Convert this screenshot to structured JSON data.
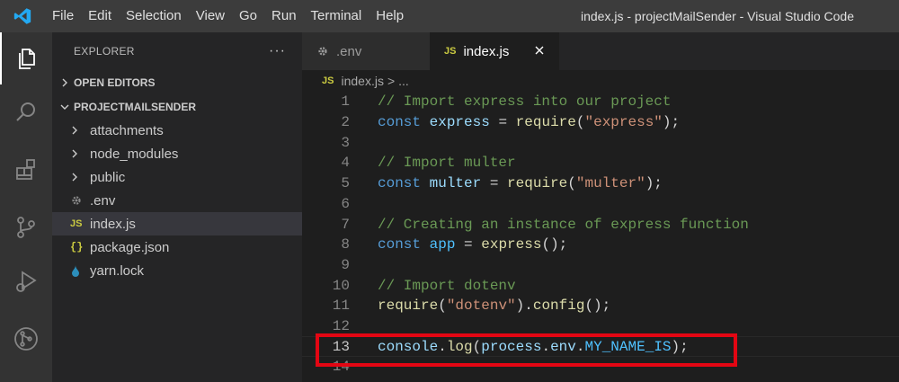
{
  "menu": [
    "File",
    "Edit",
    "Selection",
    "View",
    "Go",
    "Run",
    "Terminal",
    "Help"
  ],
  "window_title": "index.js - projectMailSender - Visual Studio Code",
  "activity_icons": [
    "explorer-icon",
    "search-icon",
    "extensions-icon",
    "source-control-icon",
    "run-debug-icon",
    "git-graph-icon"
  ],
  "sidebar": {
    "title": "EXPLORER",
    "more": "···",
    "open_editors": "OPEN EDITORS",
    "project": "PROJECTMAILSENDER",
    "items": [
      {
        "label": "attachments",
        "kind": "folder"
      },
      {
        "label": "node_modules",
        "kind": "folder"
      },
      {
        "label": "public",
        "kind": "folder"
      },
      {
        "label": ".env",
        "kind": "gear"
      },
      {
        "label": "index.js",
        "kind": "js",
        "selected": true
      },
      {
        "label": "package.json",
        "kind": "json"
      },
      {
        "label": "yarn.lock",
        "kind": "yarn"
      }
    ]
  },
  "tabs": [
    {
      "label": ".env",
      "icon": "gear-icon"
    },
    {
      "label": "index.js",
      "icon": "JS",
      "active": true
    }
  ],
  "breadcrumb": {
    "icon": "JS",
    "file": "index.js",
    "sep": ">",
    "rest": "..."
  },
  "colors": {
    "highlight_box": "#e30613",
    "accent_js": "#cbcb41"
  },
  "code_lines": [
    {
      "n": "1",
      "tokens": [
        [
          "c-comment",
          "// Import express into our project"
        ]
      ]
    },
    {
      "n": "2",
      "tokens": [
        [
          "c-kw",
          "const"
        ],
        [
          "c-plain",
          " "
        ],
        [
          "c-var",
          "express"
        ],
        [
          "c-op",
          " = "
        ],
        [
          "c-fn",
          "require"
        ],
        [
          "c-plain",
          "("
        ],
        [
          "c-str",
          "\"express\""
        ],
        [
          "c-plain",
          ");"
        ]
      ]
    },
    {
      "n": "3",
      "tokens": []
    },
    {
      "n": "4",
      "tokens": [
        [
          "c-comment",
          "// Import multer"
        ]
      ]
    },
    {
      "n": "5",
      "tokens": [
        [
          "c-kw",
          "const"
        ],
        [
          "c-plain",
          " "
        ],
        [
          "c-var",
          "multer"
        ],
        [
          "c-op",
          " = "
        ],
        [
          "c-fn",
          "require"
        ],
        [
          "c-plain",
          "("
        ],
        [
          "c-str",
          "\"multer\""
        ],
        [
          "c-plain",
          ");"
        ]
      ]
    },
    {
      "n": "6",
      "tokens": []
    },
    {
      "n": "7",
      "tokens": [
        [
          "c-comment",
          "// Creating an instance of express function"
        ]
      ]
    },
    {
      "n": "8",
      "tokens": [
        [
          "c-kw",
          "const"
        ],
        [
          "c-plain",
          " "
        ],
        [
          "c-const",
          "app"
        ],
        [
          "c-op",
          " = "
        ],
        [
          "c-fn",
          "express"
        ],
        [
          "c-plain",
          "();"
        ]
      ]
    },
    {
      "n": "9",
      "tokens": []
    },
    {
      "n": "10",
      "tokens": [
        [
          "c-comment",
          "// Import dotenv"
        ]
      ]
    },
    {
      "n": "11",
      "tokens": [
        [
          "c-fn",
          "require"
        ],
        [
          "c-plain",
          "("
        ],
        [
          "c-str",
          "\"dotenv\""
        ],
        [
          "c-plain",
          ")."
        ],
        [
          "c-fn",
          "config"
        ],
        [
          "c-plain",
          "();"
        ]
      ]
    },
    {
      "n": "12",
      "tokens": []
    },
    {
      "n": "13",
      "tokens": [
        [
          "c-var",
          "console"
        ],
        [
          "c-plain",
          "."
        ],
        [
          "c-fn",
          "log"
        ],
        [
          "c-plain",
          "("
        ],
        [
          "c-var",
          "process"
        ],
        [
          "c-plain",
          "."
        ],
        [
          "c-var",
          "env"
        ],
        [
          "c-plain",
          "."
        ],
        [
          "c-const",
          "MY_NAME_IS"
        ],
        [
          "c-plain",
          ");"
        ]
      ],
      "active": true
    },
    {
      "n": "14",
      "tokens": []
    }
  ]
}
